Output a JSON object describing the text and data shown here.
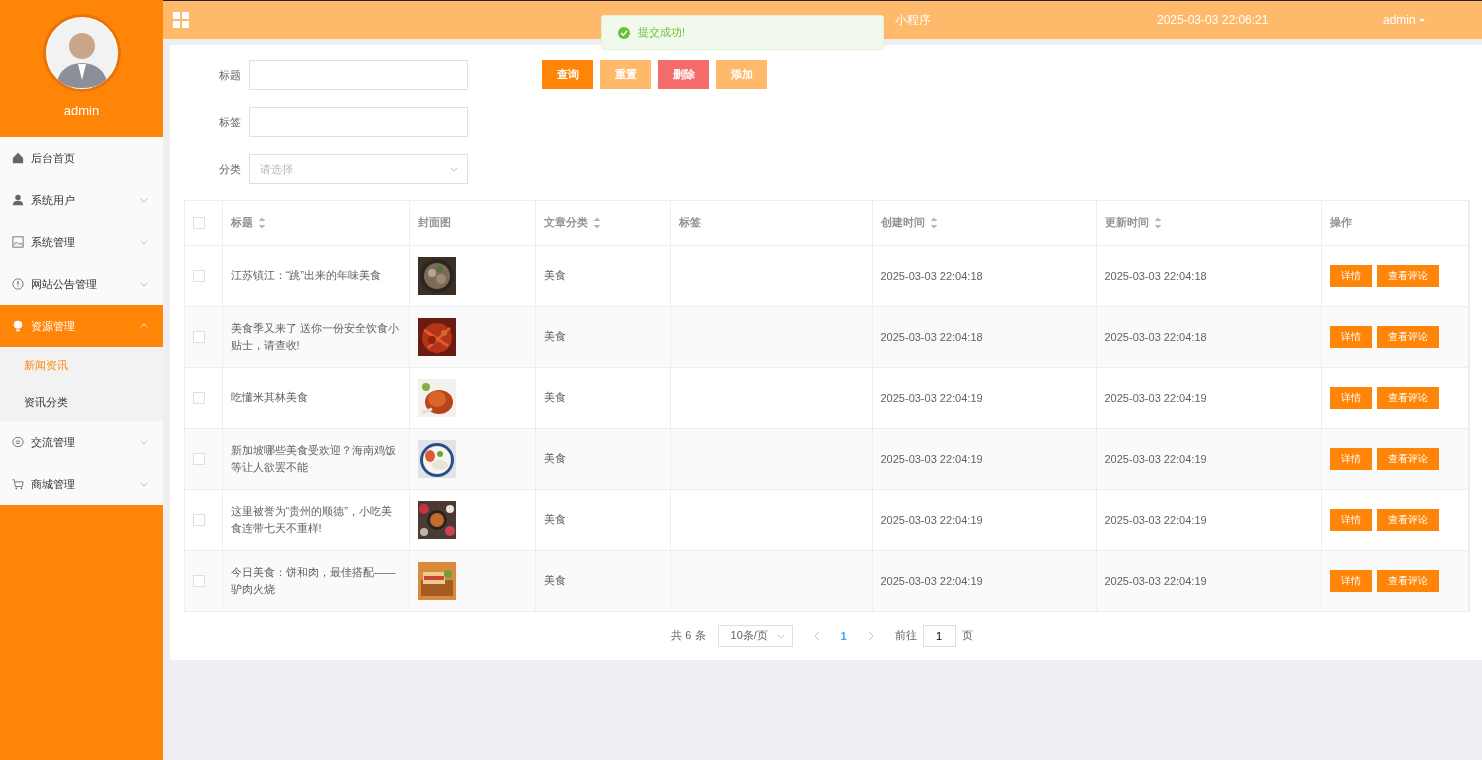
{
  "header": {
    "title_visible": "小程序",
    "datetime": "2025-03-03 22:06:21",
    "user": "admin"
  },
  "toast": {
    "kind": "success",
    "message": "提交成功!"
  },
  "sidebar": {
    "username": "admin",
    "items": [
      {
        "label": "后台首页"
      },
      {
        "label": "系统用户",
        "expanded": false,
        "selected": false
      },
      {
        "label": "系统管理",
        "expanded": false,
        "selected": false
      },
      {
        "label": "网站公告管理",
        "expanded": false,
        "selected": false
      },
      {
        "label": "资源管理",
        "expanded": true,
        "selected": true,
        "children": [
          {
            "label": "新闻资讯",
            "selected": true
          },
          {
            "label": "资讯分类",
            "selected": false
          }
        ]
      },
      {
        "label": "交流管理",
        "expanded": false,
        "selected": false
      },
      {
        "label": "商城管理",
        "expanded": false,
        "selected": false
      }
    ]
  },
  "filters": [
    {
      "label": "标题",
      "kind": "text"
    },
    {
      "label": "标签",
      "kind": "text"
    },
    {
      "label": "分类",
      "kind": "select",
      "placeholder": "请选择"
    }
  ],
  "buttons": [
    {
      "label": "查询",
      "kind": "primary"
    },
    {
      "label": "重置",
      "kind": "light"
    },
    {
      "label": "删除",
      "kind": "danger"
    },
    {
      "label": "添加",
      "kind": "light"
    }
  ],
  "table": {
    "select_all": {
      "checked": false
    },
    "columns": [
      {
        "label": "标题",
        "sortable": true
      },
      {
        "label": "封面图",
        "sortable": false
      },
      {
        "label": "文章分类",
        "sortable": true
      },
      {
        "label": "标签",
        "sortable": false
      },
      {
        "label": "创建时间",
        "sortable": true
      },
      {
        "label": "更新时间",
        "sortable": true
      },
      {
        "label": "操作",
        "sortable": false
      }
    ],
    "rows": [
      {
        "checked": false,
        "title": "江苏镇江：“跳”出来的年味美食",
        "category": "美食",
        "created": "2025-03-03 22:04:18",
        "updated": "2025-03-03 22:04:18",
        "actions": [
          "详情",
          "查看评论"
        ]
      },
      {
        "checked": false,
        "title": "美食季又来了 送你一份安全饮食小贴士，请查收!",
        "category": "美食",
        "created": "2025-03-03 22:04:18",
        "updated": "2025-03-03 22:04:18",
        "actions": [
          "详情",
          "查看评论"
        ]
      },
      {
        "checked": false,
        "title": "吃懂米其林美食",
        "category": "美食",
        "created": "2025-03-03 22:04:19",
        "updated": "2025-03-03 22:04:19",
        "actions": [
          "详情",
          "查看评论"
        ]
      },
      {
        "checked": false,
        "title": "新加坡哪些美食受欢迎？海南鸡饭等让人欲罢不能",
        "category": "美食",
        "created": "2025-03-03 22:04:19",
        "updated": "2025-03-03 22:04:19",
        "actions": [
          "详情",
          "查看评论"
        ]
      },
      {
        "checked": false,
        "title": "这里被誉为“贵州的顺德”，小吃美食连带七天不重样!",
        "category": "美食",
        "created": "2025-03-03 22:04:19",
        "updated": "2025-03-03 22:04:19",
        "actions": [
          "详情",
          "查看评论"
        ]
      },
      {
        "checked": false,
        "title": "今日美食：饼和肉，最佳搭配——驴肉火烧",
        "category": "美食",
        "created": "2025-03-03 22:04:19",
        "updated": "2025-03-03 22:04:19",
        "actions": [
          "详情",
          "查看评论"
        ]
      }
    ]
  },
  "pagination": {
    "total": "共 6 条",
    "page_size": "10条/页",
    "pages": [
      {
        "label": "1",
        "selected": true
      }
    ],
    "goto_label": "前往",
    "goto_value": "1",
    "goto_unit": "页"
  }
}
